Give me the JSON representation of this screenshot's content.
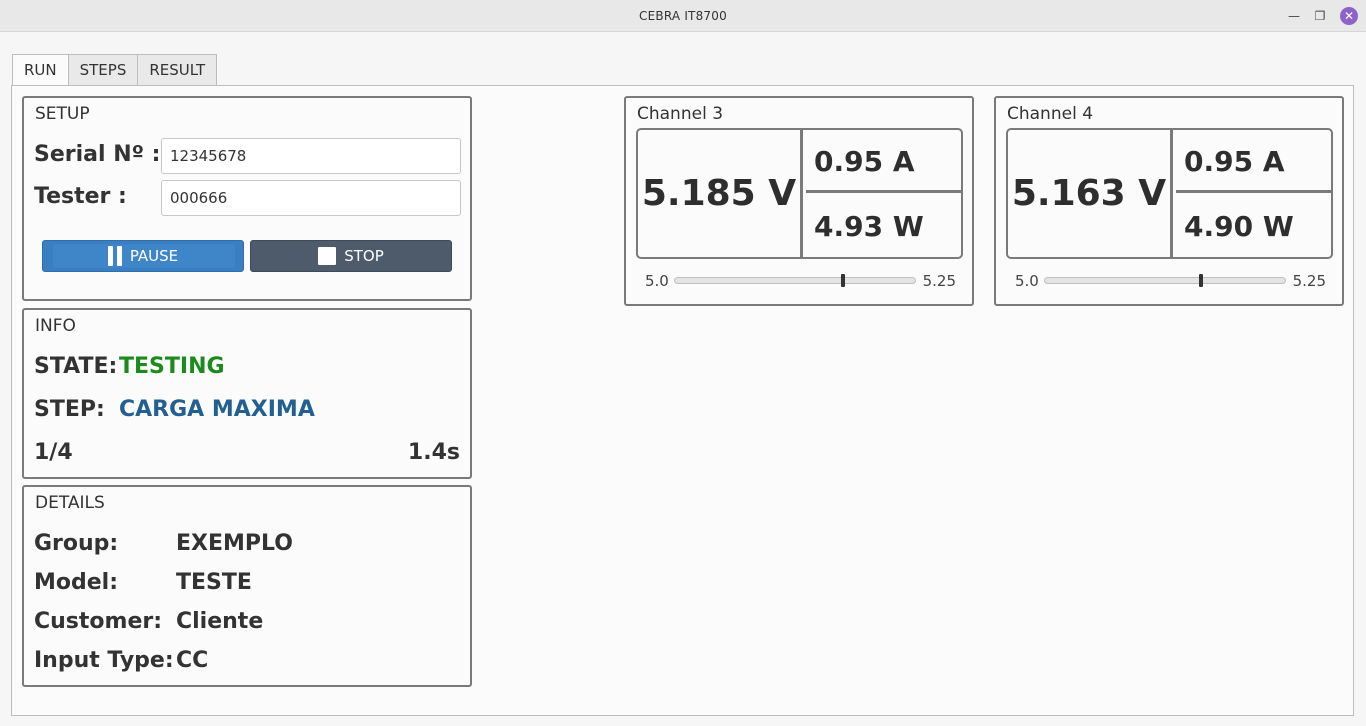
{
  "window": {
    "title": "CEBRA IT8700",
    "min_icon": "minimize-icon",
    "max_icon": "restore-icon",
    "close_icon": "close-icon"
  },
  "tabs": [
    {
      "label": "RUN",
      "active": true
    },
    {
      "label": "STEPS",
      "active": false
    },
    {
      "label": "RESULT",
      "active": false
    }
  ],
  "setup": {
    "title": "SETUP",
    "serial_label": "Serial Nº :",
    "serial_value": "12345678",
    "tester_label": "Tester :",
    "tester_value": "000666",
    "pause_label": "PAUSE",
    "stop_label": "STOP"
  },
  "info": {
    "title": "INFO",
    "state_label": "STATE:",
    "state_value": "TESTING",
    "step_label": "STEP:",
    "step_value": "CARGA MAXIMA",
    "progress": "1/4",
    "elapsed": "1.4s"
  },
  "details": {
    "title": "DETAILS",
    "rows": [
      {
        "label": "Group:",
        "value": "EXEMPLO"
      },
      {
        "label": "Model:",
        "value": "TESTE"
      },
      {
        "label": "Customer:",
        "value": "Cliente"
      },
      {
        "label": "Input Type:",
        "value": "CC"
      }
    ]
  },
  "channels": [
    {
      "title": "Channel 3",
      "voltage": "5.185 V",
      "current": "0.95 A",
      "power": "4.93 W",
      "min": "5.0",
      "max": "5.25",
      "level": 0.7
    },
    {
      "title": "Channel 4",
      "voltage": "5.163 V",
      "current": "0.95 A",
      "power": "4.90 W",
      "min": "5.0",
      "max": "5.25",
      "level": 0.65
    }
  ],
  "colors": {
    "state": "#1c8a1c",
    "step": "#235f91",
    "pause": "#3a7fc1",
    "stop": "#4d5b6a",
    "close": "#8e63c9"
  }
}
